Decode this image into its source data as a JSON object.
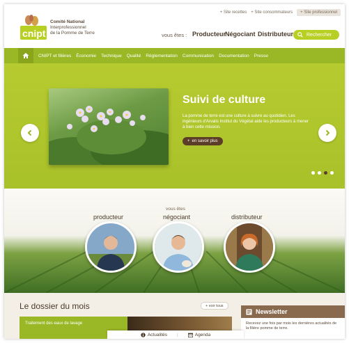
{
  "header": {
    "top_links": [
      "Site recettes",
      "Site consommateurs",
      "Site professionnel"
    ],
    "logo_word": "cnipt",
    "logo_lines": [
      "Comité National",
      "Interprofessionnel",
      "de la Pomme de Terre"
    ],
    "vous_etes": "vous êtes :",
    "roles": [
      "Producteur",
      "Négociant",
      "Distributeur"
    ],
    "search_label": "Rechercher"
  },
  "nav": {
    "home_icon": "home-icon",
    "items": [
      "CNIPT et filières",
      "Économie",
      "Technique",
      "Qualité",
      "Réglementation",
      "Communication",
      "Documentation",
      "Presse"
    ]
  },
  "hero": {
    "title": "Suivi de culture",
    "text": "La pomme de terre est une culture à suivre au quotidien. Les ingénieurs d'Arvalis Institut du Végétal aide les producteurs à mener à bien cette mission.",
    "more_label": "en savoir plus",
    "slide_count": 4,
    "active_slide": 3
  },
  "profiles": {
    "vous_etes": "vous êtes",
    "items": [
      {
        "label": "producteur"
      },
      {
        "label": "négociant"
      },
      {
        "label": "distributeur"
      }
    ]
  },
  "dossier": {
    "title": "Le dossier du mois",
    "voir_tous": "voir tous",
    "card_text": "Traitement des eaux de lavage"
  },
  "newsletter": {
    "title": "Newsletter",
    "text": "Recevez une fois par mois les dernières actualités de la filière pomme de terre."
  },
  "bottom_tabs": [
    "Actualités",
    "Agenda"
  ],
  "colors": {
    "accent_green": "#9ab726",
    "brown": "#5c3e28",
    "newsletter_brown": "#8a6a4e"
  }
}
